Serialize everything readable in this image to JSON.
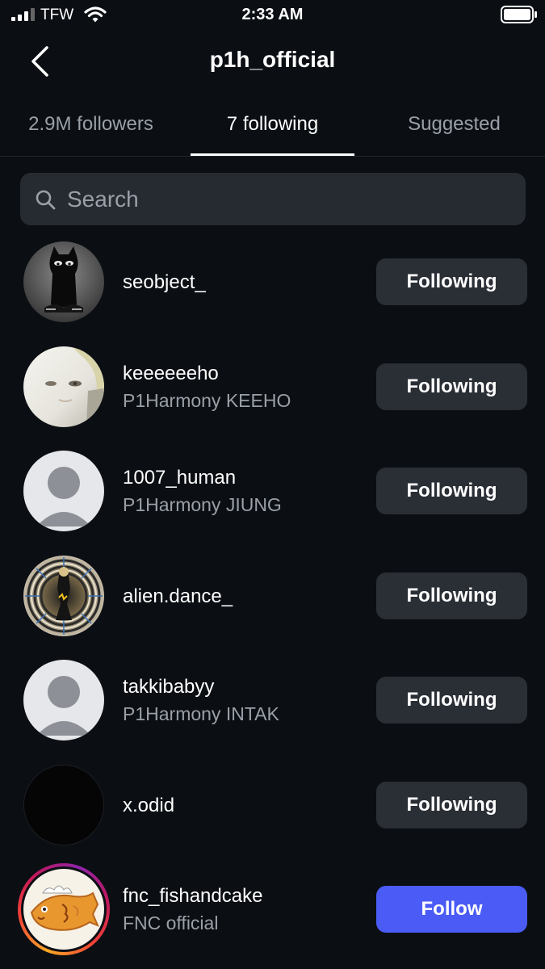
{
  "status_bar": {
    "carrier": "TFW",
    "time": "2:33 AM"
  },
  "header": {
    "title": "p1h_official",
    "back_icon": "chevron-left-icon"
  },
  "tabs": [
    {
      "label": "2.9M followers",
      "active": false
    },
    {
      "label": "7 following",
      "active": true
    },
    {
      "label": "Suggested",
      "active": false
    }
  ],
  "search": {
    "placeholder": "Search",
    "value": "",
    "icon": "search-icon"
  },
  "colors": {
    "background": "#0b0e13",
    "button_secondary": "#2a2e35",
    "button_primary": "#4a5cf5",
    "secondary_text": "#9aa0a8"
  },
  "following": [
    {
      "username": "seobject_",
      "subtitle": "",
      "button": "Following",
      "avatar": "black-cat-avatar"
    },
    {
      "username": "keeeeeeho",
      "subtitle": "P1Harmony KEEHO",
      "button": "Following",
      "avatar": "face-photo-avatar"
    },
    {
      "username": "1007_human",
      "subtitle": "P1Harmony JIUNG",
      "button": "Following",
      "avatar": "default-user-avatar"
    },
    {
      "username": "alien.dance_",
      "subtitle": "",
      "button": "Following",
      "avatar": "psychedelic-pattern-avatar"
    },
    {
      "username": "takkibabyy",
      "subtitle": "P1Harmony INTAK",
      "button": "Following",
      "avatar": "default-user-avatar"
    },
    {
      "username": "x.odid",
      "subtitle": "",
      "button": "Following",
      "avatar": "black-avatar"
    },
    {
      "username": "fnc_fishandcake",
      "subtitle": "FNC official",
      "button": "Follow",
      "avatar": "fish-cake-avatar",
      "has_story": true
    }
  ]
}
